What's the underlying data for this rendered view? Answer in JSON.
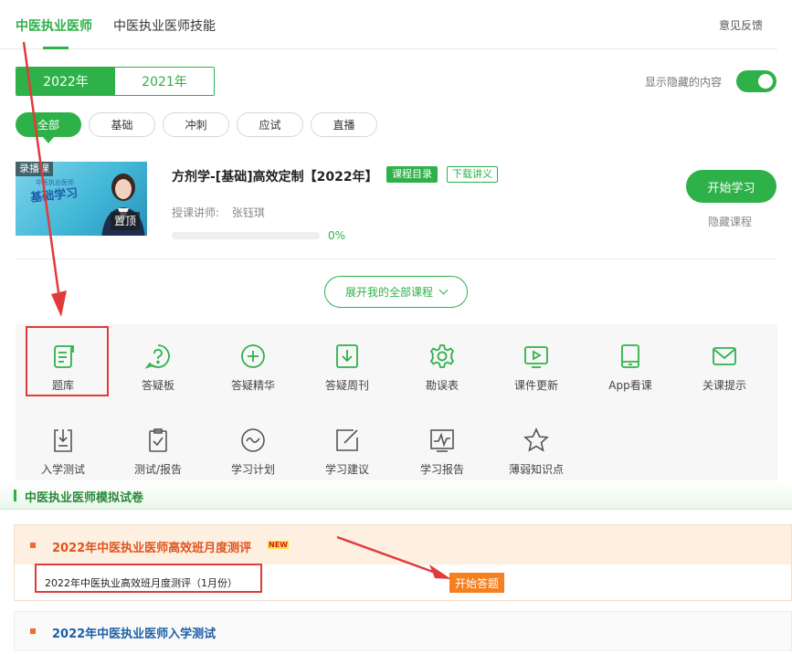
{
  "top_tabs": [
    {
      "label": "中医执业医师",
      "active": true
    },
    {
      "label": "中医执业医师技能",
      "active": false
    }
  ],
  "feedback_label": "意见反馈",
  "years": [
    {
      "label": "2022年",
      "active": true
    },
    {
      "label": "2021年",
      "active": false
    }
  ],
  "show_hidden": {
    "label": "显示隐藏的内容",
    "on": true
  },
  "filters": [
    {
      "label": "全部",
      "active": true
    },
    {
      "label": "基础",
      "active": false
    },
    {
      "label": "冲刺",
      "active": false
    },
    {
      "label": "应试",
      "active": false
    },
    {
      "label": "直播",
      "active": false
    }
  ],
  "course": {
    "thumb_tag": "录播课",
    "thumb_title": "基础学习",
    "thumb_sub": "中医执业医师",
    "pin_label": "置顶",
    "title": "方剂学-[基础]高效定制【2022年】",
    "tag_catalog": "课程目录",
    "tag_download": "下载讲义",
    "teacher_label": "授课讲师:",
    "teacher_name": "张钰琪",
    "progress_pct": 0,
    "progress_text": "0%",
    "start_label": "开始学习",
    "hide_label": "隐藏课程"
  },
  "expand_label": "展开我的全部课程",
  "tools": [
    {
      "label": "题库",
      "icon": "question-bank-icon"
    },
    {
      "label": "答疑板",
      "icon": "qa-board-icon"
    },
    {
      "label": "答疑精华",
      "icon": "plus-circle-icon"
    },
    {
      "label": "答疑周刊",
      "icon": "download-box-icon"
    },
    {
      "label": "勘误表",
      "icon": "gear-icon"
    },
    {
      "label": "课件更新",
      "icon": "play-screen-icon"
    },
    {
      "label": "App看课",
      "icon": "tablet-icon"
    },
    {
      "label": "关课提示",
      "icon": "mail-icon"
    },
    {
      "label": "入学测试",
      "icon": "entrance-test-icon"
    },
    {
      "label": "测试/报告",
      "icon": "clipboard-check-icon"
    },
    {
      "label": "学习计划",
      "icon": "wave-circle-icon"
    },
    {
      "label": "学习建议",
      "icon": "edit-square-icon"
    },
    {
      "label": "学习报告",
      "icon": "chart-report-icon"
    },
    {
      "label": "薄弱知识点",
      "icon": "star-icon"
    }
  ],
  "exam_section": {
    "title": "中医执业医师模拟试卷"
  },
  "exam1": {
    "title": "2022年中医执业医师高效班月度测评",
    "badge": "NEW",
    "item": "2022年中医执业高效班月度测评（1月份）",
    "answer_label": "开始答题"
  },
  "exam2": {
    "title": "2022年中医执业医师入学测试"
  },
  "colors": {
    "brand": "#2fb14a",
    "accent_orange": "#f58020",
    "annotation_red": "#e23a3a"
  }
}
